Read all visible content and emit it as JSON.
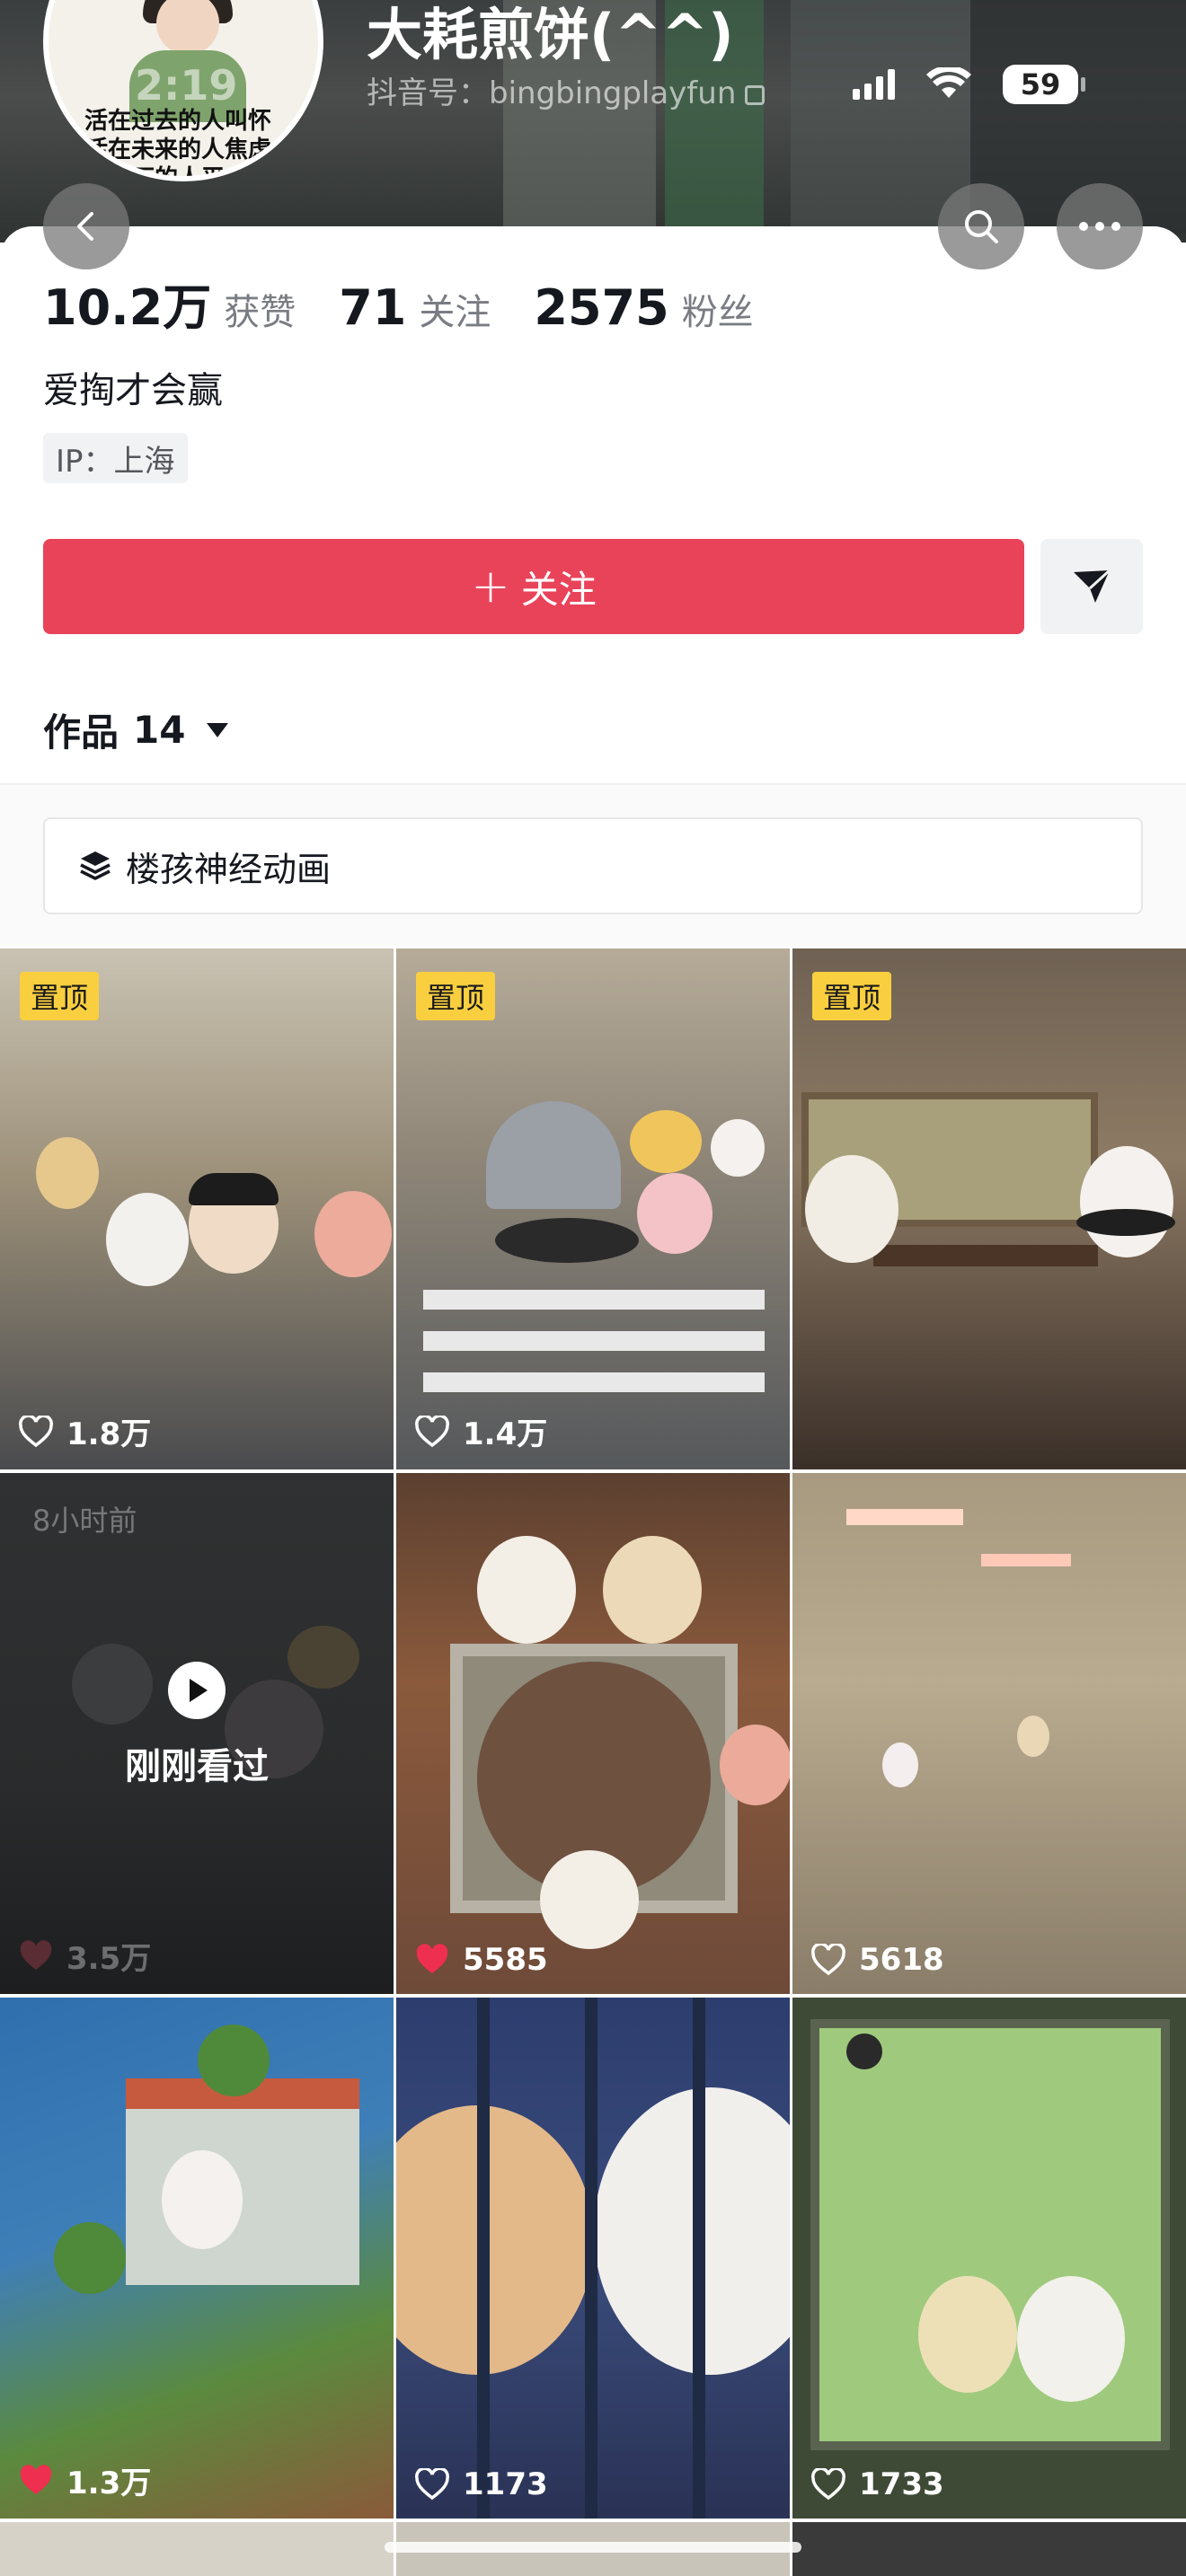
{
  "status_bar": {
    "time": "2:19",
    "battery": "59"
  },
  "avatar": {
    "lines": [
      "活在过去的人叫怀",
      "活在未来的人焦虑",
      "在当下的人平"
    ]
  },
  "profile": {
    "name": "大耗煎饼(^^)",
    "douyin_id": "抖音号：bingbingplayfun",
    "stats": [
      {
        "value": "10.2万",
        "label": "获赞"
      },
      {
        "value": "71",
        "label": "关注"
      },
      {
        "value": "2575",
        "label": "粉丝"
      }
    ],
    "bio": "爱掏才会赢",
    "ip": "IP：上海"
  },
  "actions": {
    "follow_label": "关注",
    "follow_plus": "+"
  },
  "tabs": {
    "works_label": "作品",
    "works_count": "14"
  },
  "collection": {
    "label": "楼孩神经动画"
  },
  "videos": [
    {
      "pinned": "置顶",
      "likes": "1.8万",
      "liked": false,
      "colors": [
        "#c7b48c",
        "#4d4f53"
      ]
    },
    {
      "pinned": "置顶",
      "likes": "1.4万",
      "liked": false,
      "colors": [
        "#b6a791",
        "#575a5d"
      ]
    },
    {
      "pinned": "置顶",
      "likes": "",
      "liked": false,
      "colors": [
        "#8d7a64",
        "#3a2f28"
      ]
    },
    {
      "ago": "8小时前",
      "watched_label": "刚刚看过",
      "likes": "3.5万",
      "liked": true,
      "colors": [
        "#2d2f30",
        "#1f2021"
      ]
    },
    {
      "likes": "5585",
      "liked": true,
      "colors": [
        "#8b5a3c",
        "#6e4a39"
      ]
    },
    {
      "likes": "5618",
      "liked": false,
      "colors": [
        "#b9ab8f",
        "#8a7d69"
      ]
    },
    {
      "likes": "1.3万",
      "liked": true,
      "colors": [
        "#2f6fae",
        "#5b8a3e"
      ]
    },
    {
      "likes": "1173",
      "liked": false,
      "colors": [
        "#2c3d6e",
        "#d9b689"
      ]
    },
    {
      "likes": "1733",
      "liked": false,
      "colors": [
        "#9fca7d",
        "#3e4a36"
      ]
    }
  ],
  "colors": {
    "accent": "#e9435a",
    "pin": "#f9cf3f"
  }
}
